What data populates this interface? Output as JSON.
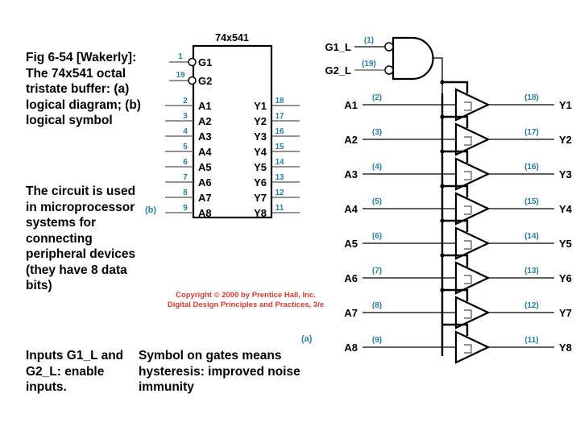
{
  "figure": {
    "caption": "Fig 6-54 [Wakerly]: The 74x541 octal tristate buffer: (a) logical diagram; (b) logical symbol",
    "usage": "The circuit is used in microprocessor systems for connecting peripheral devices (they have 8 data bits)",
    "enable_note": "Inputs G1_L and G2_L: enable inputs.",
    "hysteresis_note": "Symbol on gates means hysteresis: improved noise immunity",
    "copyright_line1": "Copyright © 2000 by Prentice Hall, Inc.",
    "copyright_line2": "Digital Design Principles and Practices, 3/e",
    "part_a_label": "(a)",
    "part_b_label": "(b)",
    "accent_color": "#2a7f9e",
    "copyright_color": "#d63b2f"
  },
  "symbol": {
    "device_name": "74x541",
    "enable_pins": [
      {
        "name": "G1",
        "number": "1",
        "inverted": true
      },
      {
        "name": "G2",
        "number": "19",
        "inverted": true
      }
    ],
    "inputs": [
      {
        "name": "A1",
        "number": "2"
      },
      {
        "name": "A2",
        "number": "3"
      },
      {
        "name": "A3",
        "number": "4"
      },
      {
        "name": "A4",
        "number": "5"
      },
      {
        "name": "A5",
        "number": "6"
      },
      {
        "name": "A6",
        "number": "7"
      },
      {
        "name": "A7",
        "number": "8"
      },
      {
        "name": "A8",
        "number": "9"
      }
    ],
    "outputs": [
      {
        "name": "Y1",
        "number": "18"
      },
      {
        "name": "Y2",
        "number": "17"
      },
      {
        "name": "Y3",
        "number": "16"
      },
      {
        "name": "Y4",
        "number": "15"
      },
      {
        "name": "Y5",
        "number": "14"
      },
      {
        "name": "Y6",
        "number": "13"
      },
      {
        "name": "Y7",
        "number": "12"
      },
      {
        "name": "Y8",
        "number": "11"
      }
    ]
  },
  "logic_diagram": {
    "gate_type": "NAND with inverted inputs",
    "enable_inputs": [
      {
        "label": "G1_L",
        "number": "(1)"
      },
      {
        "label": "G2_L",
        "number": "(19)"
      }
    ],
    "channels": [
      {
        "in_label": "A1",
        "in_number": "(2)",
        "out_label": "Y1",
        "out_number": "(18)"
      },
      {
        "in_label": "A2",
        "in_number": "(3)",
        "out_label": "Y2",
        "out_number": "(17)"
      },
      {
        "in_label": "A3",
        "in_number": "(4)",
        "out_label": "Y3",
        "out_number": "(16)"
      },
      {
        "in_label": "A4",
        "in_number": "(5)",
        "out_label": "Y4",
        "out_number": "(15)"
      },
      {
        "in_label": "A5",
        "in_number": "(6)",
        "out_label": "Y5",
        "out_number": "(14)"
      },
      {
        "in_label": "A6",
        "in_number": "(7)",
        "out_label": "Y6",
        "out_number": "(13)"
      },
      {
        "in_label": "A7",
        "in_number": "(8)",
        "out_label": "Y7",
        "out_number": "(12)"
      },
      {
        "in_label": "A8",
        "in_number": "(9)",
        "out_label": "Y8",
        "out_number": "(11)"
      }
    ]
  }
}
